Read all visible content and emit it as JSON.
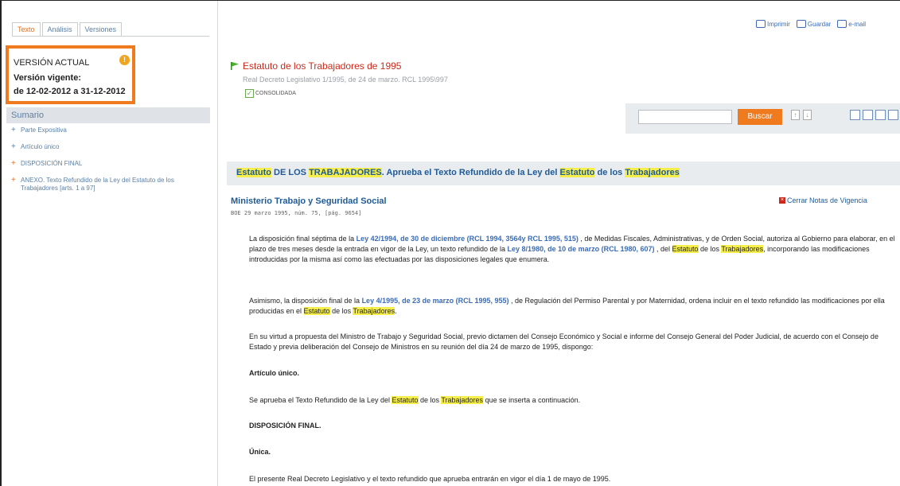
{
  "tabs": [
    "Texto",
    "Análisis",
    "Versiones"
  ],
  "version": {
    "title": "VERSIÓN ACTUAL",
    "label": "Versión vigente:",
    "dates": "de 12-02-2012 a 31-12-2012"
  },
  "sumario": "Sumario",
  "toc": [
    {
      "text": "Parte Expositiva",
      "bullet": "blue"
    },
    {
      "text": "Artículo único",
      "bullet": "blue"
    },
    {
      "text": "DISPOSICIÓN FINAL",
      "bullet": "orange"
    },
    {
      "text": "ANEXO. Texto Refundido de la Ley del Estatuto de los Trabajadores [arts. 1 a 97]",
      "bullet": "orange"
    }
  ],
  "toolbar": {
    "print": "Imprimir",
    "save": "Guardar",
    "email": "e-mail"
  },
  "doc": {
    "title": "Estatuto de los Trabajadores de 1995",
    "ref": "Real Decreto Legislativo 1/1995, de 24 de marzo. RCL 1995\\997",
    "status": "CONSOLIDADA"
  },
  "search": {
    "value": "",
    "button": "Buscar"
  },
  "section": {
    "title": [
      "Estatuto",
      " DE LOS ",
      "TRABAJADORES",
      ". Aprueba el Texto Refundido de la Ley del ",
      "Estatuto",
      " de los ",
      "Trabajadores"
    ],
    "ministry": "Ministerio Trabajo y Seguridad Social",
    "boe": "BOE 29 marzo 1995, núm. 75, [pág. 9654]",
    "close_notes": "Cerrar Notas de Vigencia"
  },
  "paragraphs": {
    "p1": [
      "La disposición final séptima de la ",
      "Ley 42/1994, de 30 de diciembre (RCL 1994, 3564y RCL 1995, 515)",
      " , de Medidas Fiscales, Administrativas, y de Orden Social, autoriza al Gobierno para elaborar, en el plazo de tres meses desde la entrada en vigor de la Ley, un texto refundido de la ",
      "Ley 8/1980, de 10 de marzo (RCL 1980, 607)",
      " , del ",
      "Estatuto",
      " de los ",
      "Trabajadores",
      ", incorporando las modificaciones introducidas por la misma así como las efectuadas por las disposiciones legales que enumera."
    ],
    "p2": [
      "Asimismo, la disposición final de la ",
      "Ley 4/1995, de 23 de marzo (RCL 1995, 955)",
      " , de Regulación del Permiso Parental y por Maternidad, ordena incluir en el texto refundido las modificaciones por ella producidas en el ",
      "Estatuto",
      " de los ",
      "Trabajadores",
      "."
    ],
    "p3": "En su virtud a propuesta del Ministro de Trabajo y Seguridad Social, previo dictamen del Consejo Económico y Social e informe del Consejo General del Poder Judicial, de acuerdo con el Consejo de Estado y previa deliberación del Consejo de Ministros en su reunión del día 24 de marzo de 1995, dispongo:",
    "h1": "Artículo único.",
    "p4": [
      "Se aprueba el Texto Refundido de la Ley del ",
      "Estatuto",
      " de los ",
      "Trabajadores",
      " que se inserta a continuación."
    ],
    "h2": "DISPOSICIÓN FINAL.",
    "h3": "Única.",
    "p5": "El presente Real Decreto Legislativo y el texto refundido que aprueba entrarán en vigor el día 1 de mayo de 1995."
  },
  "colors": {
    "accent": "#f07a1e",
    "link": "#1f5a96",
    "title_red": "#cc2a1c",
    "highlight": "#f6ee4a"
  }
}
